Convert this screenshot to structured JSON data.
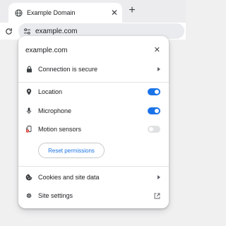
{
  "tab": {
    "title": "Example Domain",
    "close_icon": "close-icon",
    "favicon": "globe-icon"
  },
  "toolbar": {
    "new_tab_icon": "plus-icon",
    "reload_icon": "reload-icon",
    "site_info_icon": "tune-icon",
    "url": "example.com"
  },
  "popup": {
    "title": "example.com",
    "connection": {
      "label": "Connection is secure",
      "icon": "lock-icon"
    },
    "permissions": [
      {
        "label": "Location",
        "icon": "location-pin-icon",
        "enabled": true
      },
      {
        "label": "Microphone",
        "icon": "microphone-icon",
        "enabled": true
      },
      {
        "label": "Motion sensors",
        "icon": "motion-sensor-icon",
        "enabled": false
      }
    ],
    "reset_label": "Reset permissions",
    "cookies": {
      "label": "Cookies and site data",
      "icon": "cookie-icon"
    },
    "site_settings": {
      "label": "Site settings",
      "icon": "gear-icon",
      "trailing_icon": "open-external-icon"
    }
  },
  "colors": {
    "accent": "#1a73e8",
    "toggle_off": "#e0e1e3",
    "motion_icon_badge": "#d93025"
  }
}
